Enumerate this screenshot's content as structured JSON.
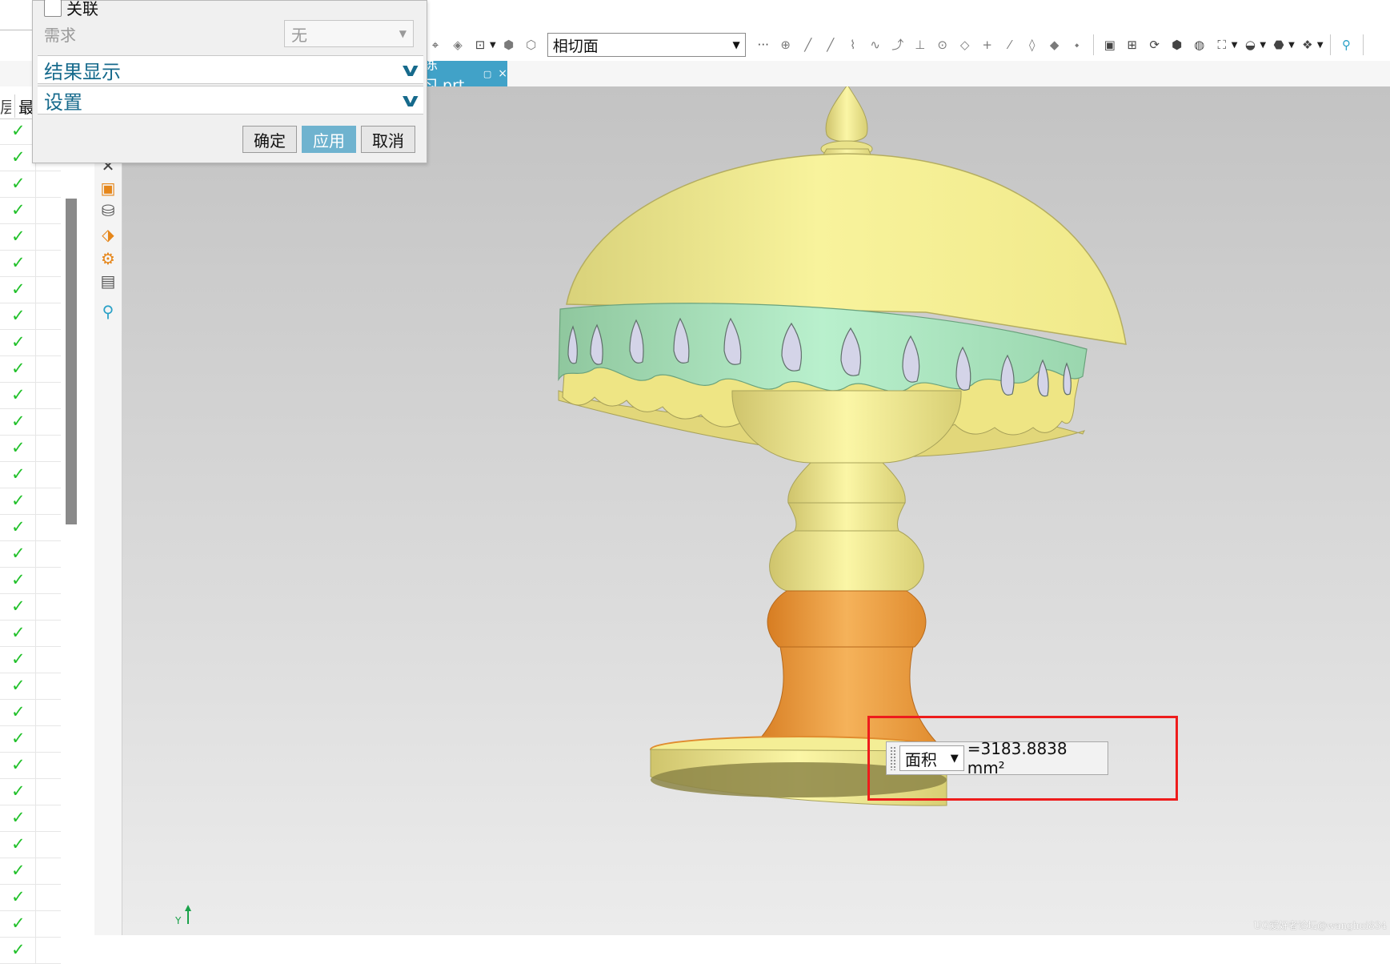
{
  "toolbar": {
    "filter_value": "相切面",
    "more_glyph": "···"
  },
  "tab": {
    "filename": "练习.prt",
    "pin": "▢",
    "close": "×"
  },
  "nav": {
    "col1_header": "层",
    "col2_header": "最",
    "check_count": 32
  },
  "dialog": {
    "associative_label": "关联",
    "requirement_label": "需求",
    "requirement_value": "无",
    "results_display_label": "结果显示",
    "settings_label": "设置",
    "ok_label": "确定",
    "apply_label": "应用",
    "cancel_label": "取消"
  },
  "measurement": {
    "type": "面积",
    "value": "=3183.8838 mm²"
  },
  "viewport": {
    "axis_label": "Y",
    "watermark": "UG爱好者论坛@wanghui834"
  },
  "colors": {
    "accent": "#41a2c8",
    "lamp_shade": "#f3ec8a",
    "lamp_band": "#a6e0bf",
    "lamp_base_orange": "#eea449",
    "highlight_box": "#ee1c1c",
    "check_green": "#22c12b"
  }
}
